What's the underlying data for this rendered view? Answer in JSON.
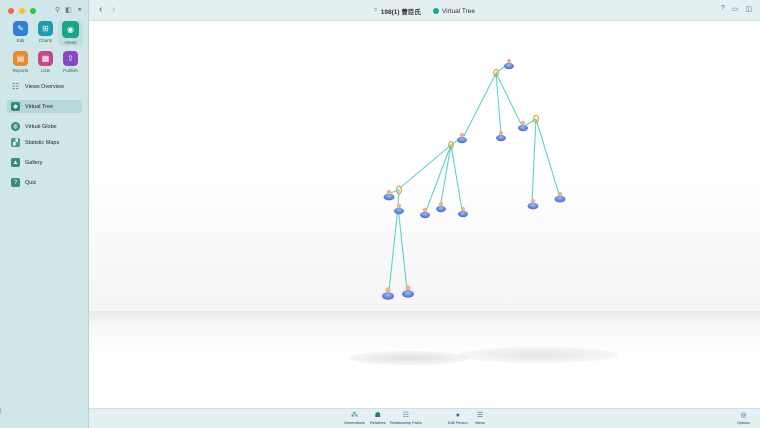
{
  "colors": {
    "accent": "#1aa58b",
    "sidebar_bg": "#cfe7e9",
    "link_line": "#5fd0cc"
  },
  "titlebar": {
    "family_title": "198(1) 曹臣氏",
    "mini_icon": "?",
    "view_name": "Virtual Tree",
    "back_icon": "chevron-left-icon",
    "forward_icon": "chevron-right-icon",
    "right_icons": [
      "help-icon",
      "window-icon",
      "sidebar-icon"
    ]
  },
  "sidebar": {
    "apps": [
      {
        "label": "Edit",
        "icon": "pencil-icon",
        "color": "#2f7fd3"
      },
      {
        "label": "Charts",
        "icon": "charts-icon",
        "color": "#1f9bb0"
      },
      {
        "label": "Views",
        "icon": "eye-icon",
        "color": "#1aa58b"
      },
      {
        "label": "Reports",
        "icon": "reports-icon",
        "color": "#e78b2c"
      },
      {
        "label": "Lists",
        "icon": "lists-icon",
        "color": "#c4478b"
      },
      {
        "label": "Publish",
        "icon": "publish-icon",
        "color": "#8a47c4"
      }
    ],
    "nav": [
      {
        "label": "Views Overview",
        "icon": "grid-icon"
      },
      {
        "label": "Virtual Tree",
        "icon": "cube-icon"
      },
      {
        "label": "Virtual Globe",
        "icon": "globe-icon"
      },
      {
        "label": "Statistic Maps",
        "icon": "map-icon"
      },
      {
        "label": "Gallery",
        "icon": "image-icon"
      },
      {
        "label": "Quiz",
        "icon": "quiz-icon"
      }
    ]
  },
  "toolbar": {
    "items": [
      {
        "label": "Generations",
        "icon": "generations-icon"
      },
      {
        "label": "Relatives",
        "icon": "relatives-icon"
      },
      {
        "label": "Relationship Paths",
        "icon": "paths-icon"
      },
      {
        "label": "Edit Person",
        "icon": "person-icon"
      },
      {
        "label": "Views",
        "icon": "views-icon"
      },
      {
        "label": "Options",
        "icon": "options-icon"
      }
    ]
  }
}
